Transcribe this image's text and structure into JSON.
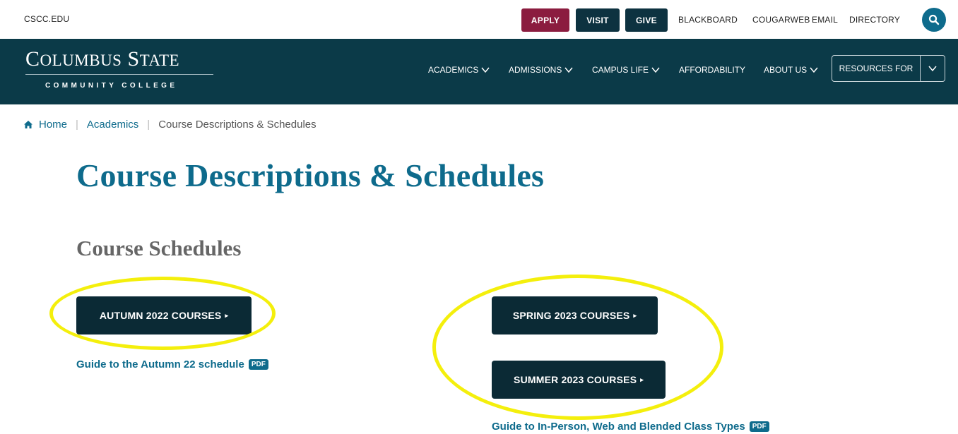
{
  "utility": {
    "site_link": "CSCC.EDU",
    "apply": "APPLY",
    "visit": "VISIT",
    "give": "GIVE",
    "links": [
      "BLACKBOARD",
      "COUGARWEB",
      "EMAIL",
      "DIRECTORY"
    ]
  },
  "logo": {
    "c": "C",
    "olumbus": "OLUMBUS",
    "s": "S",
    "tate": "TATE",
    "subtitle": "COMMUNITY COLLEGE"
  },
  "nav": {
    "items": [
      "ACADEMICS",
      "ADMISSIONS",
      "CAMPUS LIFE",
      "AFFORDABILITY",
      "ABOUT US"
    ],
    "resources": "RESOURCES FOR"
  },
  "breadcrumb": {
    "home": "Home",
    "academics": "Academics",
    "current": "Course Descriptions & Schedules"
  },
  "page_title": "Course Descriptions & Schedules",
  "section_title": "Course Schedules",
  "courses": {
    "autumn": "AUTUMN 2022 COURSES",
    "spring": "SPRING 2023 COURSES",
    "summer": "SUMMER 2023 COURSES"
  },
  "guides": {
    "autumn": "Guide to the Autumn 22 schedule",
    "types": "Guide to In-Person, Web and Blended Class Types",
    "pdf": "PDF"
  },
  "colors": {
    "apply": "#8b1c3f",
    "navy": "#0b3a48",
    "link": "#0e6b8c",
    "highlight": "#f4ef0c"
  }
}
